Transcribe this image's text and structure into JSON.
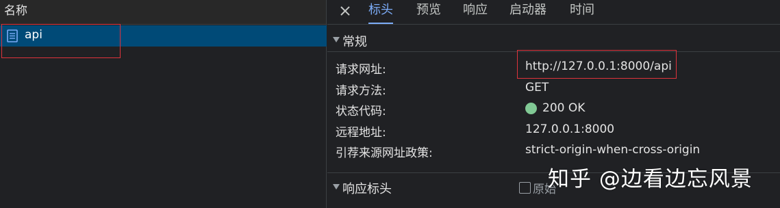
{
  "request_list": {
    "header": "名称",
    "items": [
      {
        "name": "api",
        "icon": "document-icon",
        "selected": true
      }
    ]
  },
  "tabs": [
    {
      "label": "标头",
      "active": true
    },
    {
      "label": "预览",
      "active": false
    },
    {
      "label": "响应",
      "active": false
    },
    {
      "label": "启动器",
      "active": false
    },
    {
      "label": "时间",
      "active": false
    }
  ],
  "general": {
    "title": "常规",
    "request_url_label": "请求网址:",
    "request_url_value": "http://127.0.0.1:8000/api",
    "method_label": "请求方法:",
    "method_value": "GET",
    "status_label": "状态代码:",
    "status_value": "200 OK",
    "remote_label": "远程地址:",
    "remote_value": "127.0.0.1:8000",
    "referrer_label": "引荐来源网址政策:",
    "referrer_value": "strict-origin-when-cross-origin"
  },
  "response_headers": {
    "title": "响应标头",
    "raw_label": "原始",
    "raw_checked": false
  },
  "watermark": "知乎 @边看边忘风景",
  "colors": {
    "selected_row": "#004a77",
    "active_tab": "#7cacf8",
    "status_ok": "#81c995",
    "highlight_box": "#e0333c"
  }
}
